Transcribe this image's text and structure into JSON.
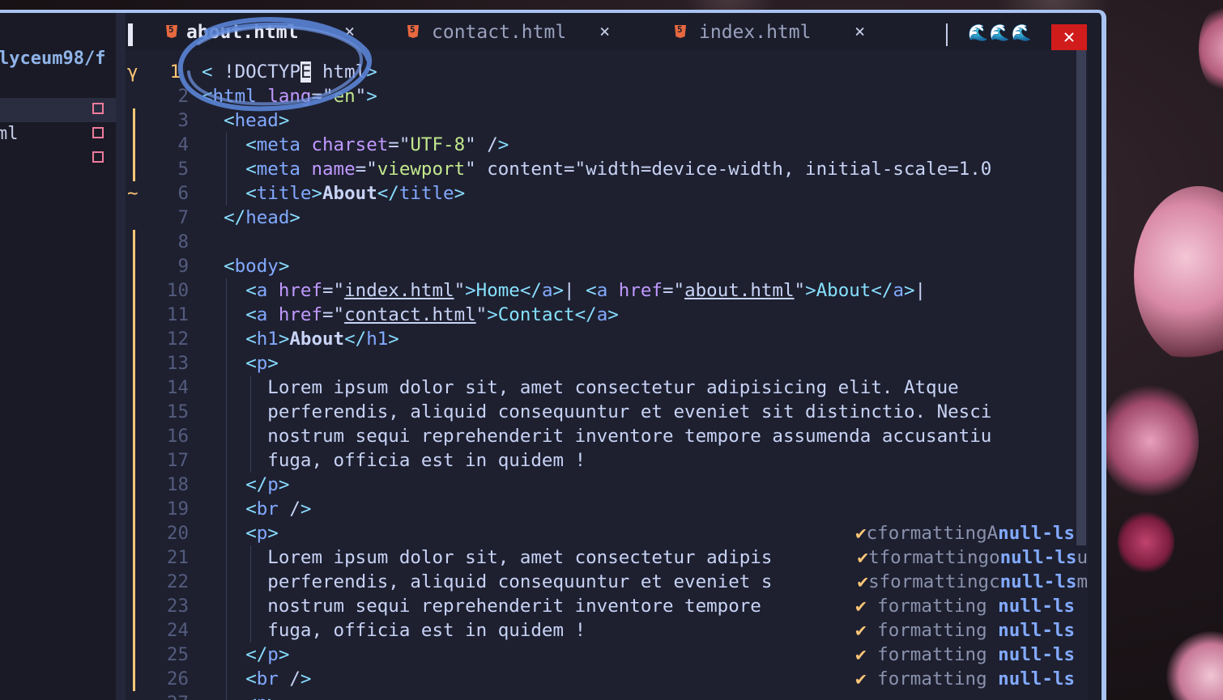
{
  "sidebar": {
    "path": "lyceum98/f",
    "rows": [
      {
        "name": "",
        "selected": true
      },
      {
        "name": "ml",
        "selected": false
      },
      {
        "name": "",
        "selected": false
      }
    ]
  },
  "tabs": [
    {
      "name": "about.html",
      "close": "×",
      "active": true
    },
    {
      "name": "contact.html",
      "close": "×",
      "active": false
    },
    {
      "name": "index.html",
      "close": "×",
      "active": false
    }
  ],
  "tab_icons": "🌊🌊🌊",
  "window_close": "✕",
  "editor": {
    "current_line_num": "1",
    "current_line_sign": "γ",
    "line6_sign": "~",
    "lines": [
      "< !DOCTYPE html>",
      "<html lang=\"en\">",
      "  <head>",
      "    <meta charset=\"UTF-8\" />",
      "    <meta name=\"viewport\" content=\"width=device-width, initial-scale=1.0",
      "    <title>About</title>",
      "  </head>",
      "",
      "  <body>",
      "    <a href=\"index.html\">Home</a>| <a href=\"about.html\">About</a>|",
      "    <a href=\"contact.html\">Contact</a>",
      "    <h1>About</h1>",
      "    <p>",
      "      Lorem ipsum dolor sit, amet consectetur adipisicing elit. Atque",
      "      perferendis, aliquid consequuntur et eveniet sit distinctio. Nesci",
      "      nostrum sequi reprehenderit inventore tempore assumenda accusantiu",
      "      fuga, officia est in quidem !",
      "    </p>",
      "    <br />",
      "    <p>",
      "      Lorem ipsum dolor sit, amet consectetur adipis",
      "      perferendis, aliquid consequuntur et eveniet s",
      "      nostrum sequi reprehenderit inventore tempore ",
      "      fuga, officia est in quidem !",
      "    </p>",
      "    <br />",
      "    <p>"
    ]
  },
  "notifications": [
    {
      "line": 20,
      "check": "✔",
      "text": "cformattingA",
      "source": "null-ls",
      "tail": ""
    },
    {
      "line": 21,
      "check": "✔",
      "text": "tformattingo",
      "source": "null-ls",
      "tail": "u"
    },
    {
      "line": 22,
      "check": "✔",
      "text": "sformattingc",
      "source": "null-ls",
      "tail": "m"
    },
    {
      "line": 23,
      "check": "✔",
      "text": " formatting ",
      "source": "null-ls",
      "tail": ""
    },
    {
      "line": 24,
      "check": "✔",
      "text": " formatting ",
      "source": "null-ls",
      "tail": ""
    },
    {
      "line": 25,
      "check": "✔",
      "text": " formatting ",
      "source": "null-ls",
      "tail": ""
    },
    {
      "line": 26,
      "check": "✔",
      "text": " formatting ",
      "source": "null-ls",
      "tail": ""
    }
  ]
}
